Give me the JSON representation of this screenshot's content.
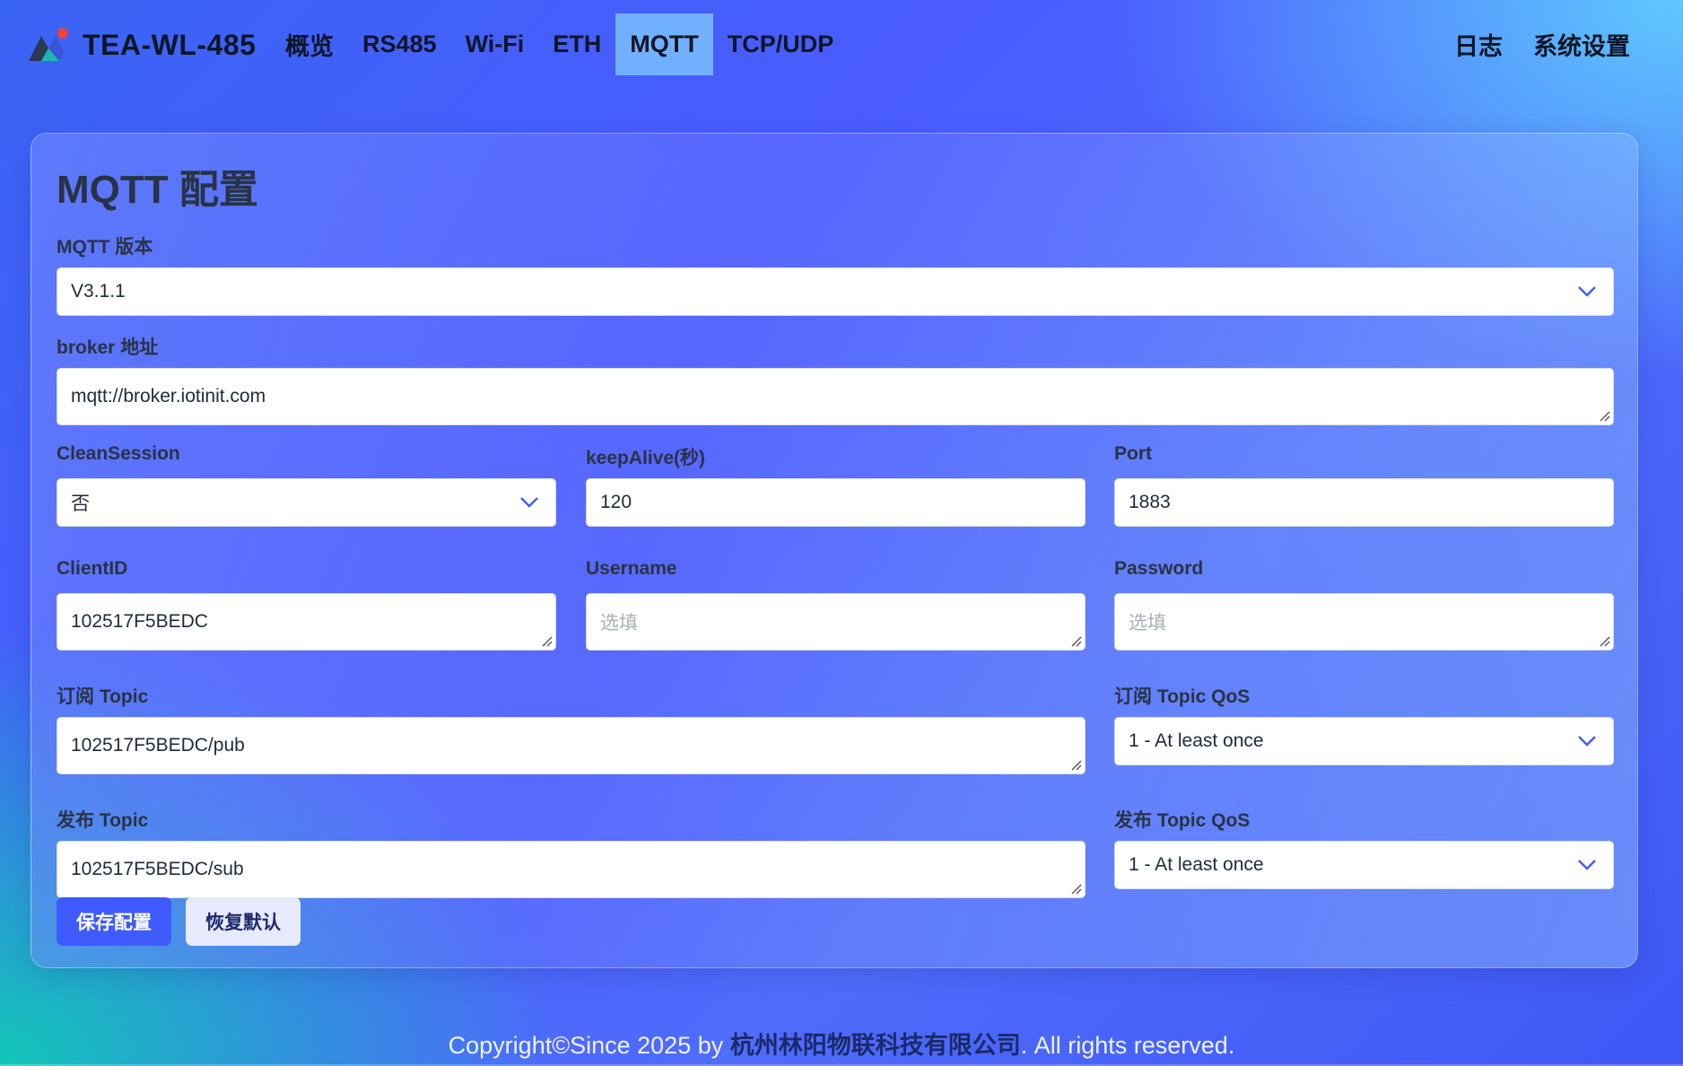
{
  "brand": {
    "name": "TEA-WL-485",
    "logo_icon": "brand-logo-icon"
  },
  "nav": {
    "items": [
      {
        "label": "概览"
      },
      {
        "label": "RS485"
      },
      {
        "label": "Wi-Fi"
      },
      {
        "label": "ETH"
      },
      {
        "label": "MQTT",
        "active": true
      },
      {
        "label": "TCP/UDP"
      }
    ],
    "right_items": [
      {
        "label": "日志"
      },
      {
        "label": "系统设置"
      }
    ]
  },
  "card": {
    "title": "MQTT 配置",
    "mqtt_version": {
      "label": "MQTT 版本",
      "value": "V3.1.1"
    },
    "broker": {
      "label": "broker 地址",
      "value": "mqtt://broker.iotinit.com"
    },
    "clean_session": {
      "label": "CleanSession",
      "value": "否"
    },
    "keep_alive": {
      "label": "keepAlive(秒)",
      "value": "120"
    },
    "port": {
      "label": "Port",
      "value": "1883"
    },
    "client_id": {
      "label": "ClientID",
      "value": "102517F5BEDC"
    },
    "username": {
      "label": "Username",
      "value": "",
      "placeholder": "选填"
    },
    "password": {
      "label": "Password",
      "value": "",
      "placeholder": "选填"
    },
    "sub_topic": {
      "label": "订阅 Topic",
      "value": "102517F5BEDC/pub"
    },
    "sub_qos": {
      "label": "订阅 Topic QoS",
      "value": "1 - At least once"
    },
    "pub_topic": {
      "label": "发布 Topic",
      "value": "102517F5BEDC/sub"
    },
    "pub_qos": {
      "label": "发布 Topic QoS",
      "value": "1 - At least once"
    },
    "save_button": "保存配置",
    "reset_button": "恢复默认"
  },
  "footer": {
    "prefix": "Copyright©Since 2025 by ",
    "company": "杭州林阳物联科技有限公司",
    "suffix": ". All rights reserved."
  },
  "colors": {
    "primary": "#3f5bff",
    "nav_active": "#78beff",
    "chevron": "#3f5bff"
  }
}
